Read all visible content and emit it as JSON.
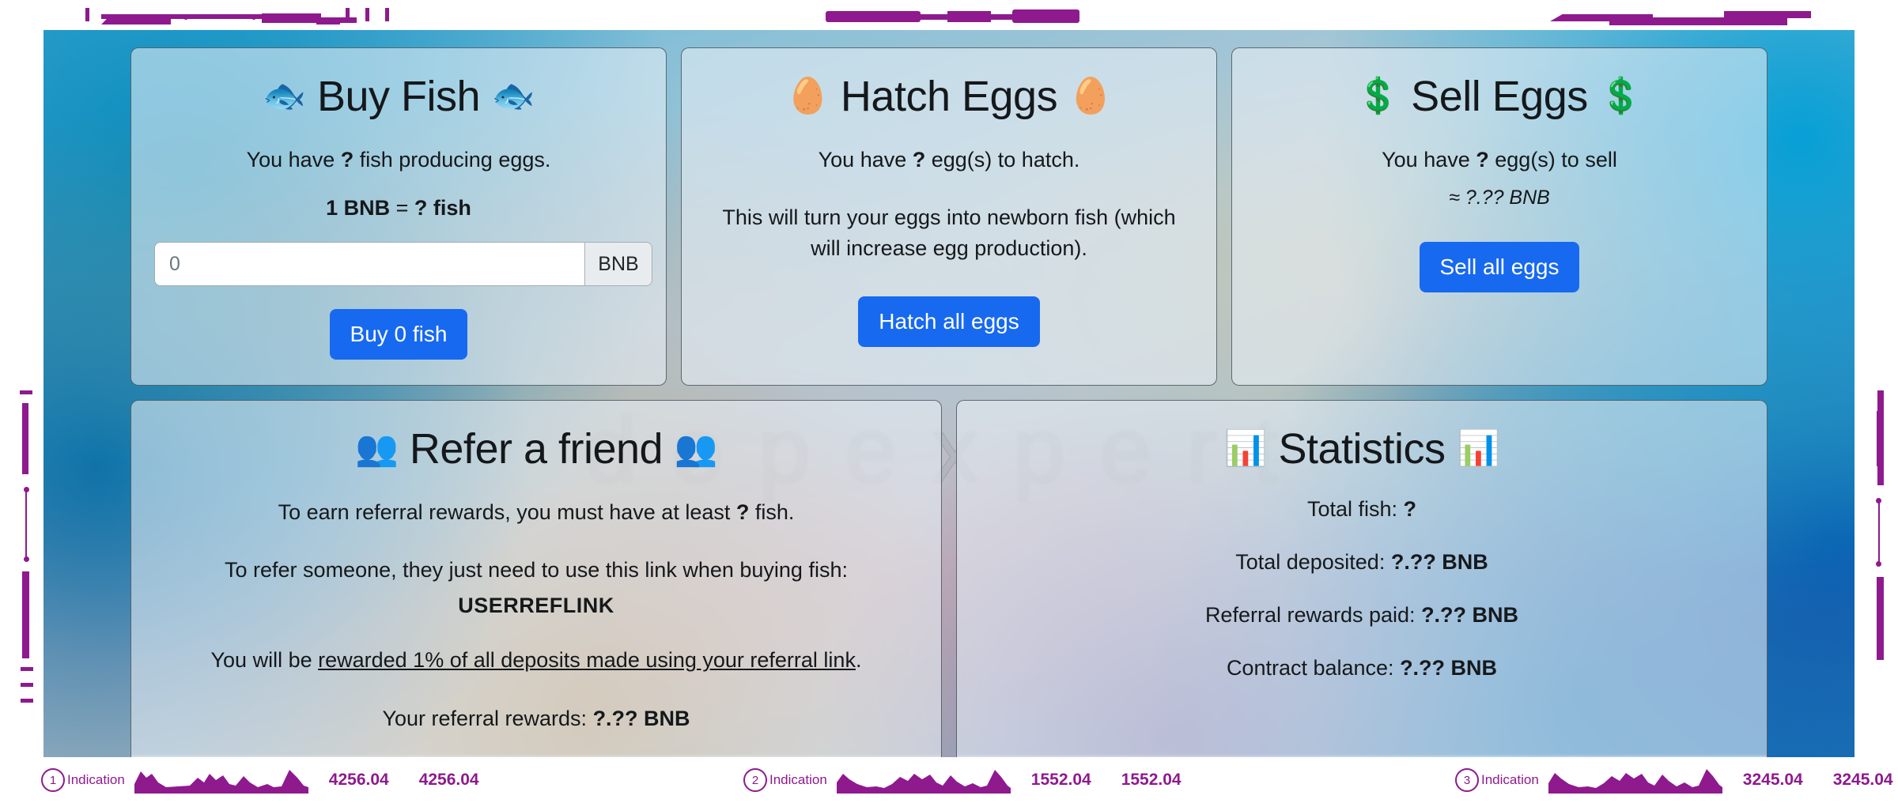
{
  "buy": {
    "title_left_icon": "fish-emoji",
    "title": "Buy Fish",
    "title_right_icon": "fish-emoji",
    "have_prefix": "You have ",
    "have_value": "?",
    "have_suffix": " fish producing eggs.",
    "rate_prefix": "1 BNB",
    "rate_mid": " = ",
    "rate_value": "?",
    "rate_suffix": " fish",
    "input_placeholder": "0",
    "input_value": "",
    "input_addon": "BNB",
    "button_label": "Buy 0 fish"
  },
  "hatch": {
    "title_left_icon": "egg-emoji",
    "title": "Hatch Eggs",
    "title_right_icon": "egg-emoji",
    "have_prefix": "You have ",
    "have_value": "?",
    "have_suffix": " egg(s) to hatch.",
    "description": "This will turn your eggs into newborn fish (which will increase egg production).",
    "button_label": "Hatch all eggs"
  },
  "sell": {
    "title_left_icon": "dollar-emoji",
    "title": "Sell Eggs",
    "title_right_icon": "dollar-emoji",
    "have_prefix": "You have ",
    "have_value": "?",
    "have_suffix": " egg(s) to sell",
    "approx_value": "≈ ?.?? BNB",
    "button_label": "Sell all eggs"
  },
  "refer": {
    "title_left_icon": "busts-in-silhouette-emoji",
    "title": "Refer a friend",
    "title_right_icon": "busts-in-silhouette-emoji",
    "requirement_prefix": "To earn referral rewards, you must have at least ",
    "requirement_value": "?",
    "requirement_suffix": " fish.",
    "instructions": "To refer someone, they just need to use this link when buying fish:",
    "ref_link": "USERREFLINK",
    "reward_prefix": "You will be ",
    "reward_link_text": "rewarded 1% of all deposits made using your referral link",
    "reward_suffix": ".",
    "rewards_label": "Your referral rewards: ",
    "rewards_value": "?.?? BNB"
  },
  "stats": {
    "title_left_icon": "bar-chart-emoji",
    "title": "Statistics",
    "title_right_icon": "bar-chart-emoji",
    "items": [
      {
        "label": "Total fish: ",
        "value": "?"
      },
      {
        "label": "Total deposited: ",
        "value": "?.?? BNB"
      },
      {
        "label": "Referral rewards paid: ",
        "value": "?.?? BNB"
      },
      {
        "label": "Contract balance: ",
        "value": "?.?? BNB"
      }
    ]
  },
  "watermark": {
    "text": "dopexpert"
  },
  "indications": [
    {
      "number": "1",
      "label": "Indication",
      "value_a": "4256.04",
      "value_b": "4256.04"
    },
    {
      "number": "2",
      "label": "Indication",
      "value_a": "1552.04",
      "value_b": "1552.04"
    },
    {
      "number": "3",
      "label": "Indication",
      "value_a": "3245.04",
      "value_b": "3245.04"
    }
  ],
  "colors": {
    "accent_button": "#1769f0",
    "deco_purple": "#8e1a8e",
    "card_bg": "rgba(233,240,246,0.58)"
  }
}
